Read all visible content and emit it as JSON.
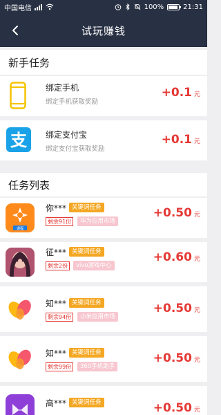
{
  "status_bar": {
    "carrier": "中国电信",
    "signal_suffix": "ᵍ",
    "battery": "100%",
    "time": "21:31"
  },
  "nav": {
    "title": "试玩赚钱",
    "back_icon": "chevron-left-icon"
  },
  "newbie": {
    "title": "新手任务",
    "items": [
      {
        "name": "绑定手机",
        "desc": "绑定手机获取奖励",
        "reward": "+0.1",
        "unit": "元",
        "icon": "phone-icon"
      },
      {
        "name": "绑定支付宝",
        "desc": "绑定支付宝获取奖励",
        "reward": "+0.1",
        "unit": "元",
        "icon": "alipay-icon"
      }
    ]
  },
  "tasks": {
    "title": "任务列表",
    "items": [
      {
        "name": "你***",
        "keyword": "关键词任务",
        "remain": "剩余91份",
        "market": "华为应用市场",
        "reward": "+0.50",
        "unit": "元",
        "icon": "app-icon-orange-star"
      },
      {
        "name": "征***",
        "keyword": "关键词任务",
        "remain": "剩余2份",
        "market": "vivo游戏中心",
        "reward": "+0.60",
        "unit": "元",
        "icon": "app-icon-game-girl"
      },
      {
        "name": "知***",
        "keyword": "关键词任务",
        "remain": "剩余94份",
        "market": "小米应用市场",
        "reward": "+0.50",
        "unit": "元",
        "icon": "app-icon-zhihu-petals"
      },
      {
        "name": "知***",
        "keyword": "关键词任务",
        "remain": "剩余99份",
        "market": "360手机助手",
        "reward": "+0.50",
        "unit": "元",
        "icon": "app-icon-zhihu-petals"
      },
      {
        "name": "高***",
        "keyword": "关键词任务",
        "remain": "",
        "market": "",
        "reward": "+0.50",
        "unit": "元",
        "icon": "app-icon-purple"
      }
    ]
  },
  "colors": {
    "header_bg": "#283043",
    "reward_red": "#e53935",
    "keyword_orange": "#f4a723",
    "market_pink": "#f7c6cf",
    "alipay_blue": "#1aa2e8",
    "phone_yellow": "#f5c400"
  }
}
